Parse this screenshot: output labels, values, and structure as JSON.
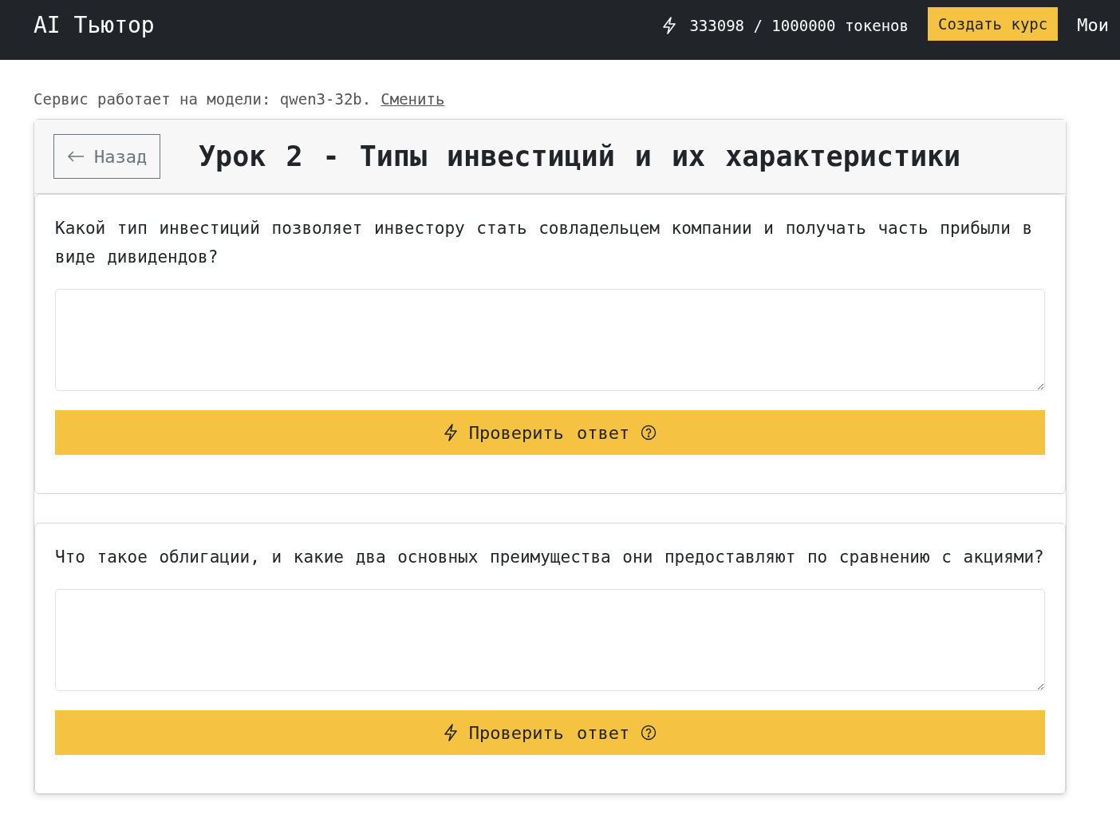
{
  "header": {
    "logo": "AI Тьютор",
    "tokens": "333098 / 1000000 токенов",
    "create_button": "Создать курс",
    "nav_link": "Мои"
  },
  "model_notice": {
    "text": "Сервис работает на модели: qwen3-32b.",
    "link": "Сменить"
  },
  "lesson": {
    "back_button": "Назад",
    "title": "Урок 2 - Типы инвестиций и их характеристики"
  },
  "questions": [
    {
      "text": "Какой тип инвестиций позволяет инвестору стать совладельцем компании и получать часть прибыли в виде дивидендов?",
      "check_button": "Проверить ответ"
    },
    {
      "text": "Что такое облигации, и какие два основных преимущества они предоставляют по сравнению с акциями?",
      "check_button": "Проверить ответ"
    }
  ]
}
